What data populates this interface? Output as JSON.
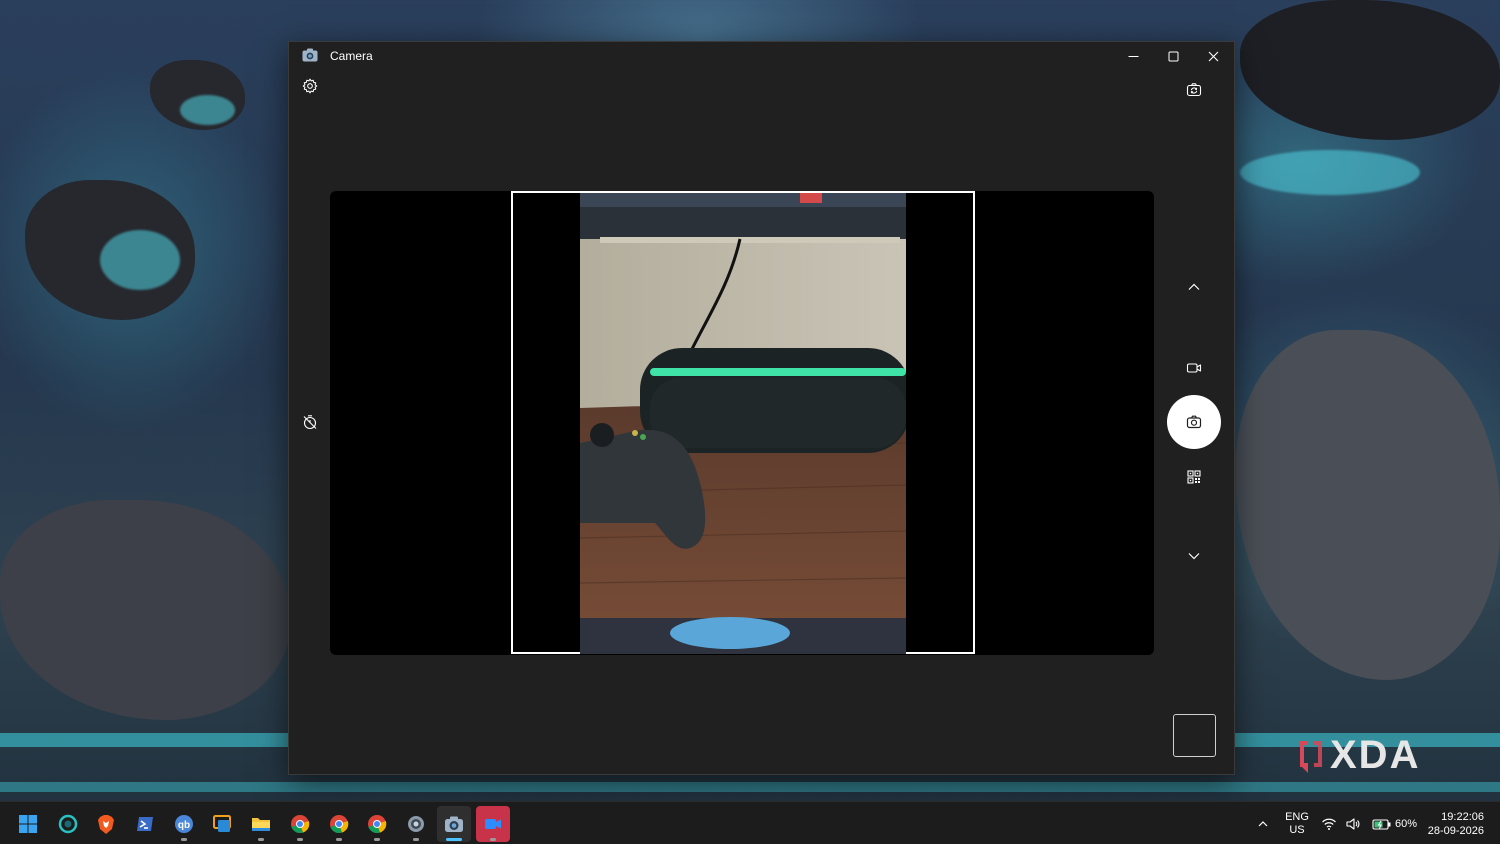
{
  "window": {
    "title": "Camera"
  },
  "camera": {
    "icons": {
      "settings": "gear-icon",
      "switch_camera": "switch-camera-icon",
      "timer": "timer-off-icon",
      "mode_up": "chevron-up-icon",
      "video_mode": "video-icon",
      "photo_mode": "camera-icon",
      "qr_mode": "qr-code-icon",
      "mode_down": "chevron-down-icon"
    }
  },
  "watermark": {
    "text": "XDA"
  },
  "taskbar": {
    "apps": [
      "start",
      "cortana",
      "brave",
      "terminal",
      "qbittorrent",
      "remote-desktop",
      "file-explorer",
      "chrome",
      "chrome",
      "chrome",
      "settings",
      "camera",
      "zoom"
    ],
    "tray": {
      "lang_line1": "ENG",
      "lang_line2": "US",
      "battery": "60%",
      "time": "19:22:06",
      "date": "28-09-2026"
    }
  },
  "colors": {
    "window_bg": "#202020",
    "viewport_bg": "#000000",
    "taskbar_bg": "#1c1c1c",
    "accent": "#4cc2ff",
    "zoom_red": "#c8334a"
  }
}
